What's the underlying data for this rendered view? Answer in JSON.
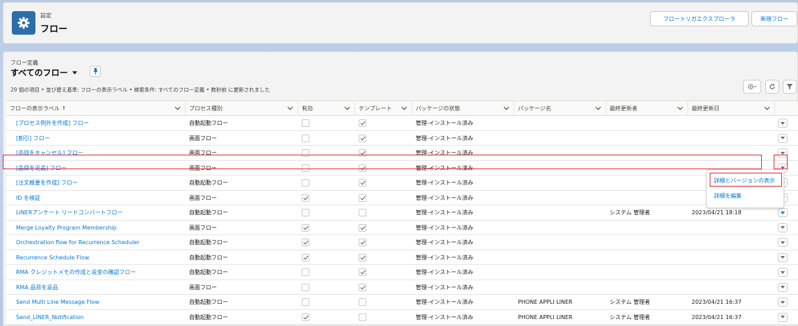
{
  "header": {
    "kicker": "設定",
    "title": "フロー",
    "buttons": [
      "フロートリガエクスプローラ",
      "新規フロー"
    ]
  },
  "list": {
    "kicker": "フロー定義",
    "title": "すべてのフロー",
    "info": "29 個の項目 • 並び替え基準: フローの表示ラベル • 検索条件: すべてのフロー定義 • 数秒前 に更新されました"
  },
  "columns": [
    {
      "label": "フローの表示ラベル ↑"
    },
    {
      "label": "プロセス種別"
    },
    {
      "label": "有効"
    },
    {
      "label": "テンプレート"
    },
    {
      "label": "パッケージの状態"
    },
    {
      "label": "パッケージ名"
    },
    {
      "label": "最終更新者"
    },
    {
      "label": "最終更新日"
    }
  ],
  "rows": [
    {
      "label": "[プロセス例外を作成] フロー",
      "type": "自動起動フロー",
      "active": false,
      "template": true,
      "pkg_state": "管理-インストール済み",
      "pkg_name": "",
      "modified_by": "",
      "modified_date": ""
    },
    {
      "label": "[割引] フロー",
      "type": "画面フロー",
      "active": false,
      "template": true,
      "pkg_state": "管理-インストール済み",
      "pkg_name": "",
      "modified_by": "",
      "modified_date": ""
    },
    {
      "label": "[品目をキャンセル] フロー",
      "type": "画面フロー",
      "active": false,
      "template": true,
      "pkg_state": "管理-インストール済み",
      "pkg_name": "",
      "modified_by": "",
      "modified_date": ""
    },
    {
      "label": "[品目を返品] フロー",
      "type": "画面フロー",
      "active": false,
      "template": true,
      "pkg_state": "管理-インストール済み",
      "pkg_name": "",
      "modified_by": "",
      "modified_date": ""
    },
    {
      "label": "[注文概要を作成] フロー",
      "type": "自動起動フロー",
      "active": false,
      "template": true,
      "pkg_state": "管理-インストール済み",
      "pkg_name": "",
      "modified_by": "",
      "modified_date": ""
    },
    {
      "label": "ID を検証",
      "type": "画面フロー",
      "active": true,
      "template": true,
      "pkg_state": "管理-インストール済み",
      "pkg_name": "",
      "modified_by": "",
      "modified_date": ""
    },
    {
      "label": "LINERアンケート リードコンバートフロー",
      "type": "自動起動フロー",
      "active": false,
      "template": false,
      "pkg_state": "管理-インストール済み",
      "pkg_name": "",
      "modified_by": "システム 管理者",
      "modified_date": "2023/04/21 18:18"
    },
    {
      "label": "Merge Loyalty Program Membership",
      "type": "画面フロー",
      "active": true,
      "template": true,
      "pkg_state": "管理-インストール済み",
      "pkg_name": "",
      "modified_by": "",
      "modified_date": ""
    },
    {
      "label": "Orchestration flow for Recurrence Scheduler",
      "type": "自動起動フロー",
      "active": true,
      "template": true,
      "pkg_state": "管理-インストール済み",
      "pkg_name": "",
      "modified_by": "",
      "modified_date": ""
    },
    {
      "label": "Recurrence Schedule Flow",
      "type": "自動起動フロー",
      "active": true,
      "template": true,
      "pkg_state": "管理-インストール済み",
      "pkg_name": "",
      "modified_by": "",
      "modified_date": ""
    },
    {
      "label": "RMA クレジットメモの作成と返金の確認フロー",
      "type": "自動起動フロー",
      "active": false,
      "template": true,
      "pkg_state": "管理-インストール済み",
      "pkg_name": "",
      "modified_by": "",
      "modified_date": ""
    },
    {
      "label": "RMA 品目を返品",
      "type": "画面フロー",
      "active": false,
      "template": true,
      "pkg_state": "管理-インストール済み",
      "pkg_name": "",
      "modified_by": "",
      "modified_date": ""
    },
    {
      "label": "Send Multi Line Message Flow",
      "type": "自動起動フロー",
      "active": false,
      "template": false,
      "pkg_state": "管理-インストール済み",
      "pkg_name": "PHONE APPLI LINER",
      "modified_by": "システム 管理者",
      "modified_date": "2023/04/21 16:37"
    },
    {
      "label": "Send_LINER_Notification",
      "type": "自動起動フロー",
      "active": true,
      "template": false,
      "pkg_state": "管理-インストール済み",
      "pkg_name": "PHONE APPLI LINER",
      "modified_by": "システム 管理者",
      "modified_date": "2023/04/21 16:37"
    }
  ],
  "row_menu": {
    "items": [
      "詳細とバージョンの表示",
      "詳細を編集"
    ]
  },
  "colors": {
    "accent": "#0176d3",
    "highlight": "#e0242f",
    "icon_bg": "#2c6ea8"
  }
}
